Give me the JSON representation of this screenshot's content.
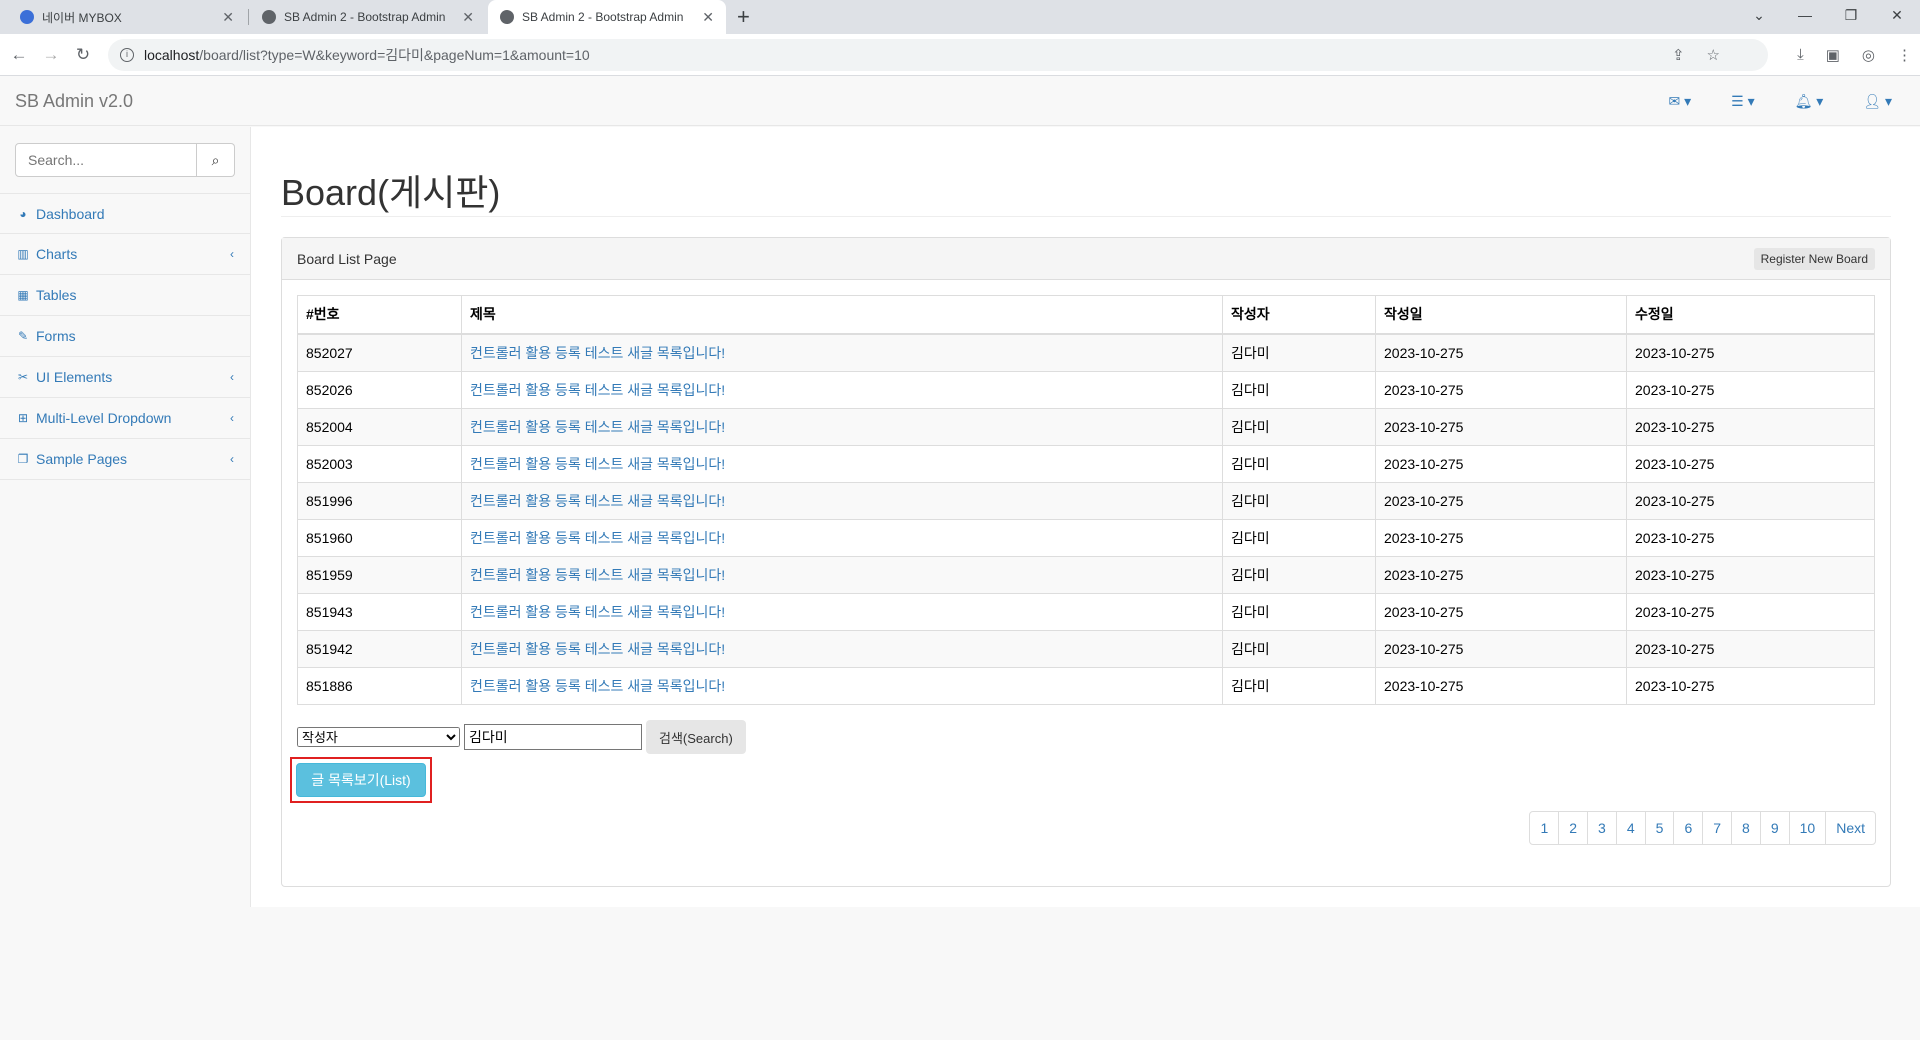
{
  "browser": {
    "tabs": [
      {
        "title": "네이버 MYBOX",
        "favicon_color": "#3b6fd8"
      },
      {
        "title": "SB Admin 2 - Bootstrap Admin",
        "favicon_color": "#5f6368"
      },
      {
        "title": "SB Admin 2 - Bootstrap Admin",
        "favicon_color": "#5f6368"
      }
    ],
    "url_host": "localhost",
    "url_path": "/board/list?type=W&keyword=김다미&pageNum=1&amount=10"
  },
  "topnav": {
    "brand": "SB Admin v2.0"
  },
  "sidebar": {
    "search_placeholder": "Search...",
    "items": [
      {
        "label": "Dashboard",
        "icon": "dashboard-icon",
        "has_arrow": false
      },
      {
        "label": "Charts",
        "icon": "bar-chart-icon",
        "has_arrow": true
      },
      {
        "label": "Tables",
        "icon": "table-icon",
        "has_arrow": false
      },
      {
        "label": "Forms",
        "icon": "edit-icon",
        "has_arrow": false
      },
      {
        "label": "UI Elements",
        "icon": "wrench-icon",
        "has_arrow": true
      },
      {
        "label": "Multi-Level Dropdown",
        "icon": "sitemap-icon",
        "has_arrow": true
      },
      {
        "label": "Sample Pages",
        "icon": "files-icon",
        "has_arrow": true
      }
    ]
  },
  "main": {
    "page_title": "Board(게시판)",
    "panel_title": "Board List Page",
    "register_button": "Register New Board",
    "table": {
      "headers": [
        "#번호",
        "제목",
        "작성자",
        "작성일",
        "수정일"
      ],
      "rows": [
        [
          "852027",
          "컨트롤러 활용 등록 테스트 새글 목록입니다!",
          "김다미",
          "2023-10-275",
          "2023-10-275"
        ],
        [
          "852026",
          "컨트롤러 활용 등록 테스트 새글 목록입니다!",
          "김다미",
          "2023-10-275",
          "2023-10-275"
        ],
        [
          "852004",
          "컨트롤러 활용 등록 테스트 새글 목록입니다!",
          "김다미",
          "2023-10-275",
          "2023-10-275"
        ],
        [
          "852003",
          "컨트롤러 활용 등록 테스트 새글 목록입니다!",
          "김다미",
          "2023-10-275",
          "2023-10-275"
        ],
        [
          "851996",
          "컨트롤러 활용 등록 테스트 새글 목록입니다!",
          "김다미",
          "2023-10-275",
          "2023-10-275"
        ],
        [
          "851960",
          "컨트롤러 활용 등록 테스트 새글 목록입니다!",
          "김다미",
          "2023-10-275",
          "2023-10-275"
        ],
        [
          "851959",
          "컨트롤러 활용 등록 테스트 새글 목록입니다!",
          "김다미",
          "2023-10-275",
          "2023-10-275"
        ],
        [
          "851943",
          "컨트롤러 활용 등록 테스트 새글 목록입니다!",
          "김다미",
          "2023-10-275",
          "2023-10-275"
        ],
        [
          "851942",
          "컨트롤러 활용 등록 테스트 새글 목록입니다!",
          "김다미",
          "2023-10-275",
          "2023-10-275"
        ],
        [
          "851886",
          "컨트롤러 활용 등록 테스트 새글 목록입니다!",
          "김다미",
          "2023-10-275",
          "2023-10-275"
        ]
      ]
    },
    "search": {
      "type_selected": "작성자",
      "keyword_value": "김다미",
      "search_button": "검색(Search)"
    },
    "list_button": "글 목록보기(List)",
    "pagination": [
      "1",
      "2",
      "3",
      "4",
      "5",
      "6",
      "7",
      "8",
      "9",
      "10",
      "Next"
    ]
  }
}
